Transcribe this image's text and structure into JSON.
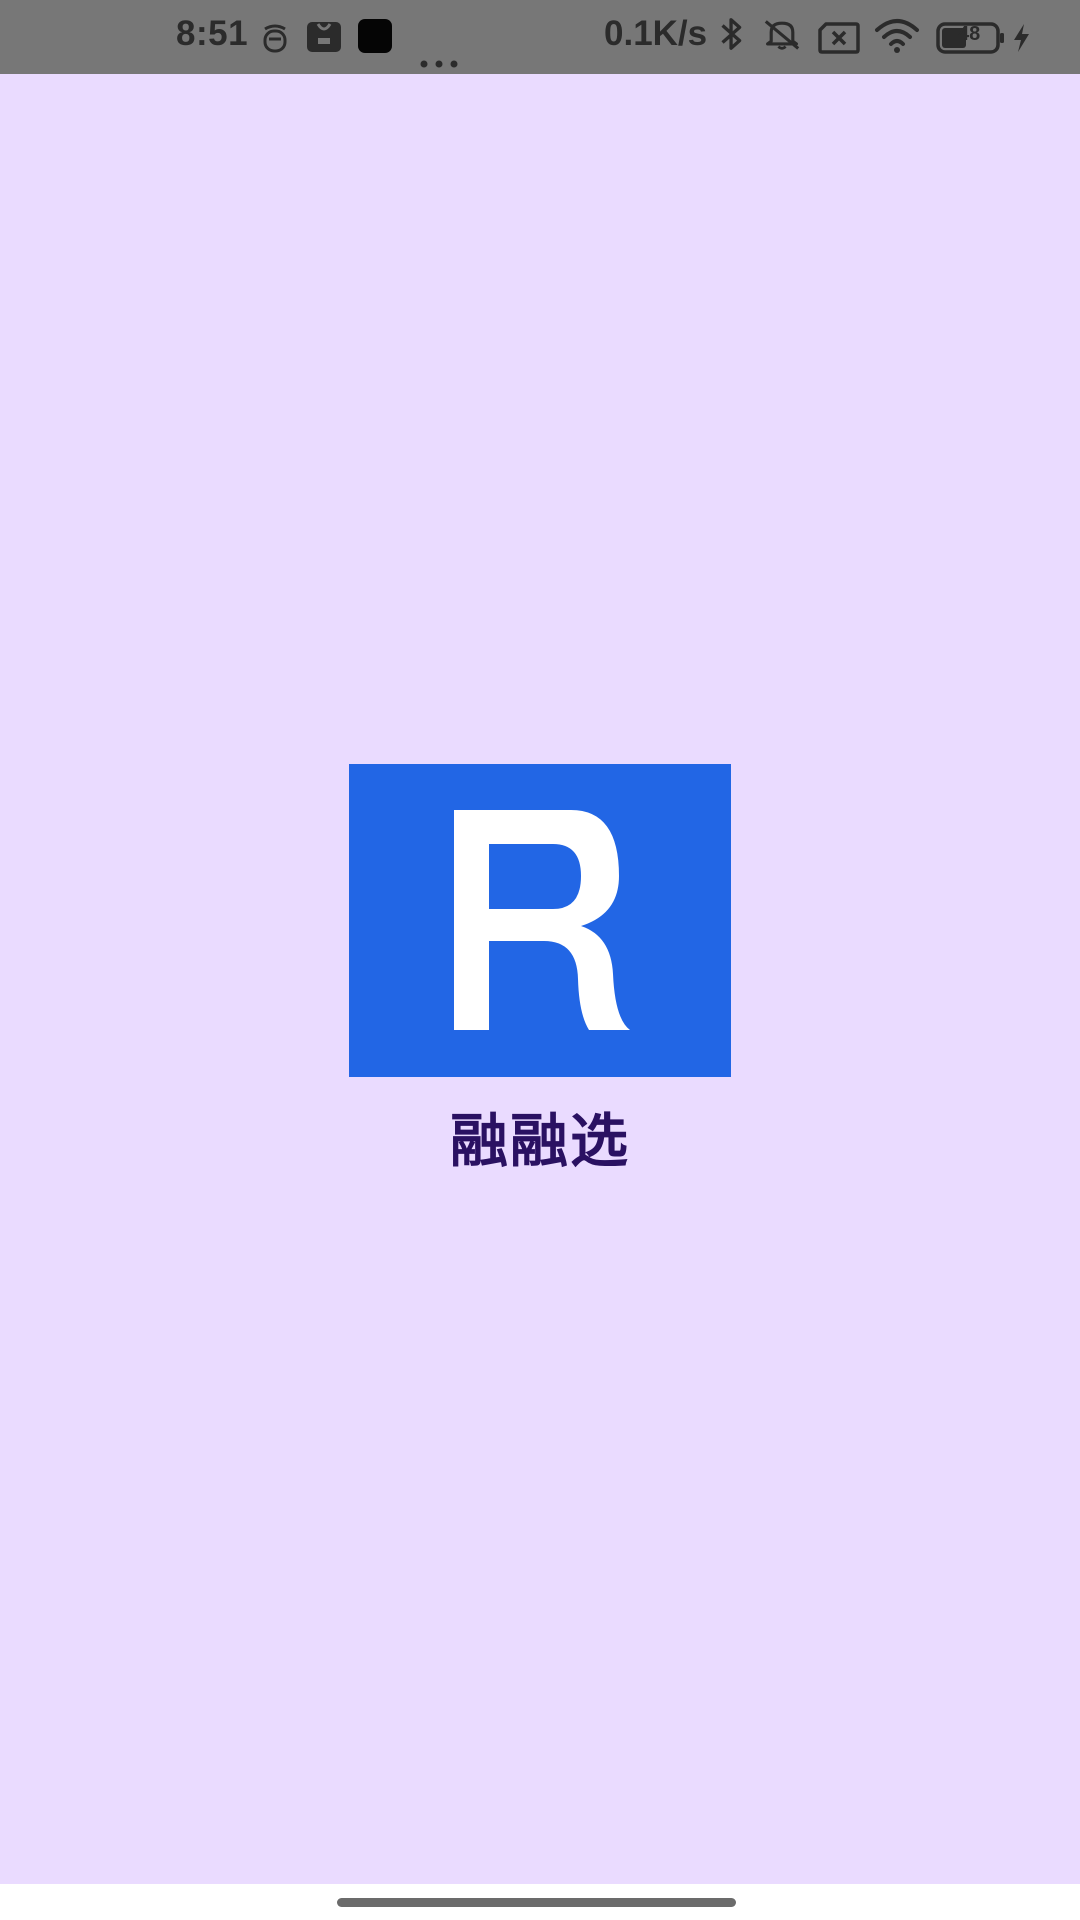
{
  "status_bar": {
    "time": "8:51",
    "network_speed": "0.1K/s",
    "battery_level": "48",
    "icons": [
      "notification-app-icon",
      "shopping-bag-icon",
      "black-square-app-icon",
      "more-dots-icon",
      "bluetooth-icon",
      "mute-bell-icon",
      "no-sim-icon",
      "wifi-icon",
      "battery-icon",
      "charging-bolt-icon"
    ]
  },
  "splash": {
    "background_color": "#eadbff",
    "logo": {
      "letter": "R",
      "background_color": "#2266e5",
      "letter_color": "#ffffff"
    },
    "app_name": "融融选",
    "app_name_color": "#2a1162"
  },
  "nav_bar": {
    "indicator_color": "#6b6b6b"
  }
}
